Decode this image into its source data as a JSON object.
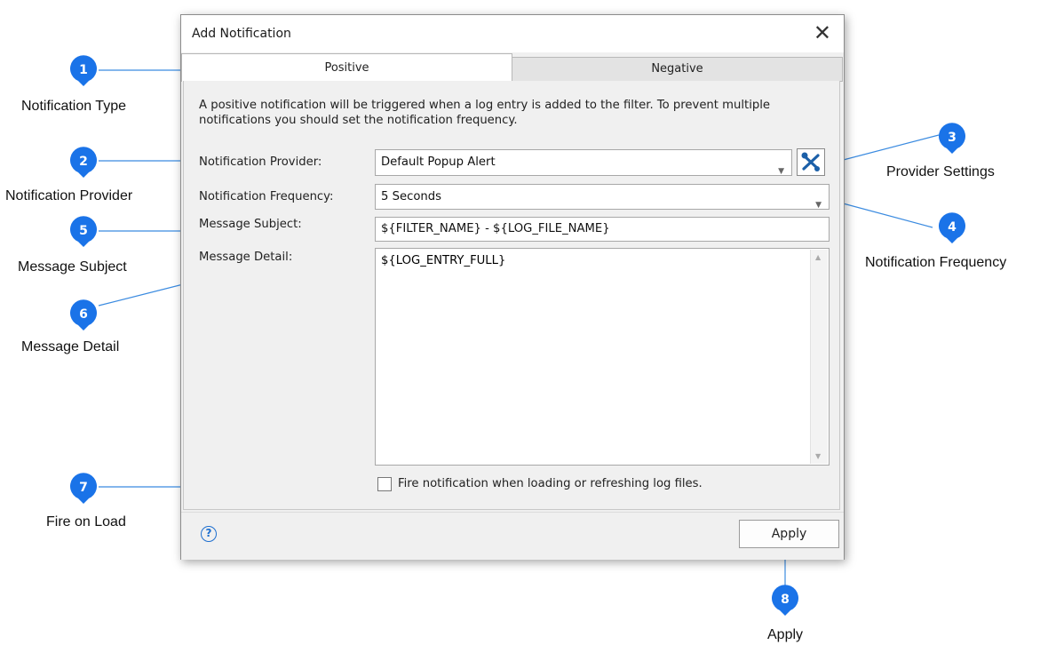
{
  "dialog": {
    "title": "Add Notification",
    "close_glyph": "✕",
    "tabs": [
      {
        "label": "Positive",
        "active": true
      },
      {
        "label": "Negative",
        "active": false
      }
    ],
    "description": "A positive notification will be triggered when a log entry is added to the filter.  To prevent multiple notifications you should set the notification frequency.",
    "provider": {
      "label": "Notification Provider:",
      "value": "Default Popup Alert",
      "settings_icon": "wrench-screwdriver-icon"
    },
    "frequency": {
      "label": "Notification Frequency:",
      "value": "5 Seconds"
    },
    "subject": {
      "label": "Message Subject:",
      "value": "${FILTER_NAME} - ${LOG_FILE_NAME}"
    },
    "detail": {
      "label": "Message Detail:",
      "value": "${LOG_ENTRY_FULL}"
    },
    "fire_on_load": {
      "label": "Fire notification when loading or refreshing log files.",
      "checked": false
    },
    "help_icon": "question-circle-icon",
    "help_glyph": "?",
    "apply_label": "Apply",
    "accent": "#1e6fcf"
  },
  "callouts": [
    {
      "number": "1",
      "label": "Notification Type"
    },
    {
      "number": "2",
      "label": "Notification Provider"
    },
    {
      "number": "3",
      "label": "Provider Settings"
    },
    {
      "number": "4",
      "label": "Notification Frequency"
    },
    {
      "number": "5",
      "label": "Message Subject"
    },
    {
      "number": "6",
      "label": "Message Detail"
    },
    {
      "number": "7",
      "label": "Fire on Load"
    },
    {
      "number": "8",
      "label": "Apply"
    }
  ],
  "callout_color": "#1a73e8"
}
